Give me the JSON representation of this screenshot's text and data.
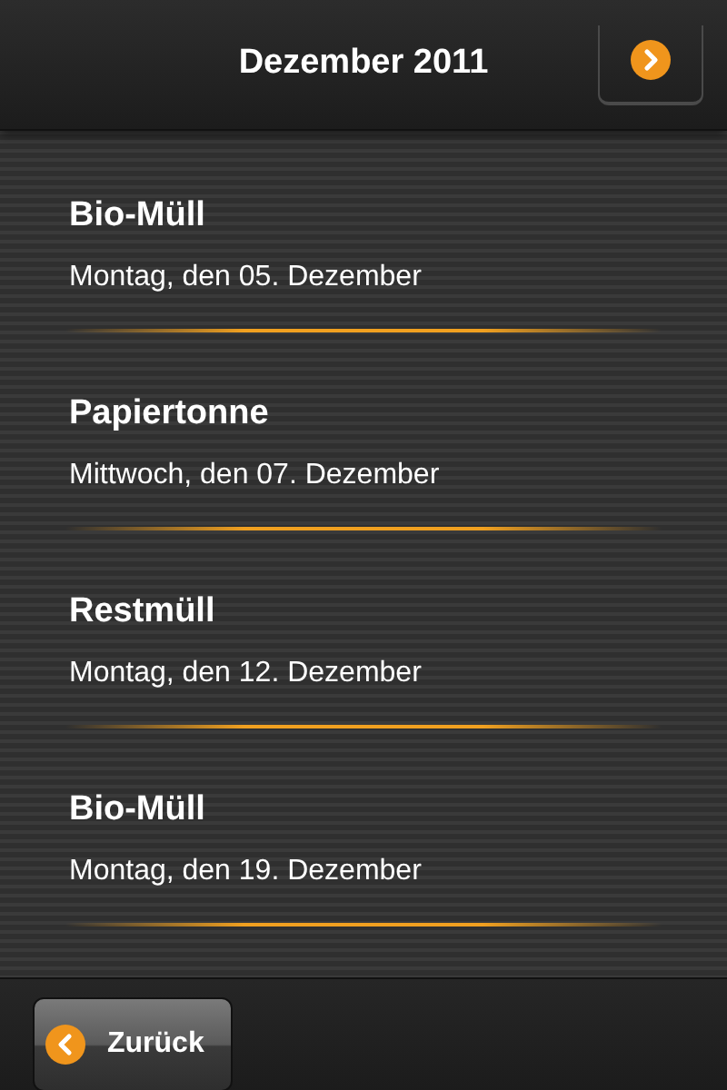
{
  "header": {
    "title": "Dezember 2011"
  },
  "entries": [
    {
      "title": "Bio-Müll",
      "date": "Montag, den 05. Dezember"
    },
    {
      "title": "Papiertonne",
      "date": "Mittwoch, den 07. Dezember"
    },
    {
      "title": "Restmüll",
      "date": "Montag, den 12. Dezember"
    },
    {
      "title": "Bio-Müll",
      "date": "Montag, den 19. Dezember"
    }
  ],
  "footer": {
    "back_button": "Zurück"
  }
}
